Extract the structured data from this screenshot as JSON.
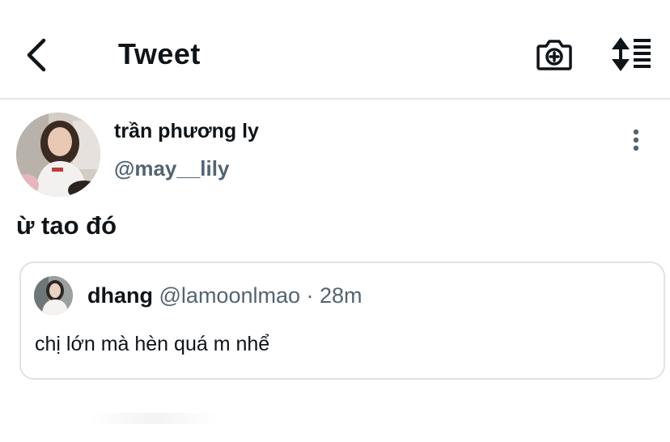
{
  "header": {
    "title": "Tweet",
    "back_icon": "chevron-left-icon",
    "camera_icon": "camera-plus-icon",
    "sort_icon": "sort-lines-icon"
  },
  "tweet": {
    "author": {
      "display_name": "trần phương ly",
      "handle": "@may__lily"
    },
    "text": "ừ tao đó",
    "more_icon": "more-vertical-icon"
  },
  "quoted_tweet": {
    "display_name": "dhang",
    "handle": "@lamoonlmao",
    "separator": " · ",
    "time": "28m",
    "text": "chị lớn mà hèn quá m nhể"
  },
  "colors": {
    "text_primary": "#0f1419",
    "text_secondary": "#536471",
    "divider": "#e2e4e6"
  }
}
